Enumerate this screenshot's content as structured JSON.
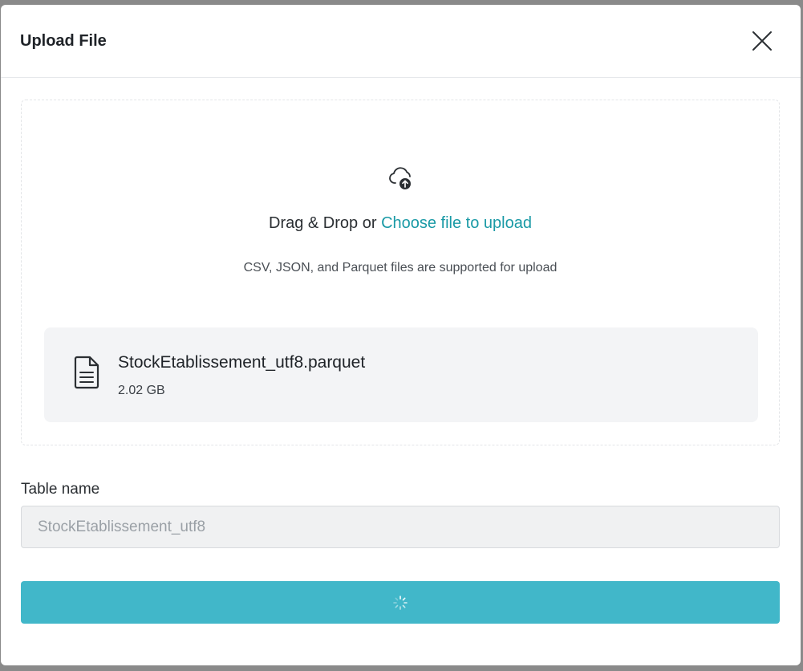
{
  "modal": {
    "title": "Upload File"
  },
  "dropzone": {
    "prompt_prefix": "Drag & Drop or ",
    "prompt_link": "Choose file to upload",
    "supported_text": "CSV, JSON, and Parquet files are supported for upload",
    "icon": "cloud-upload-icon"
  },
  "file": {
    "name": "StockEtablissement_utf8.parquet",
    "size": "2.02 GB",
    "icon": "file-text-icon"
  },
  "table_name": {
    "label": "Table name",
    "value": "StockEtablissement_utf8"
  },
  "submit": {
    "state": "loading",
    "icon": "spinner-icon"
  },
  "colors": {
    "accent": "#1a9aa6",
    "button": "#41b7c9"
  }
}
